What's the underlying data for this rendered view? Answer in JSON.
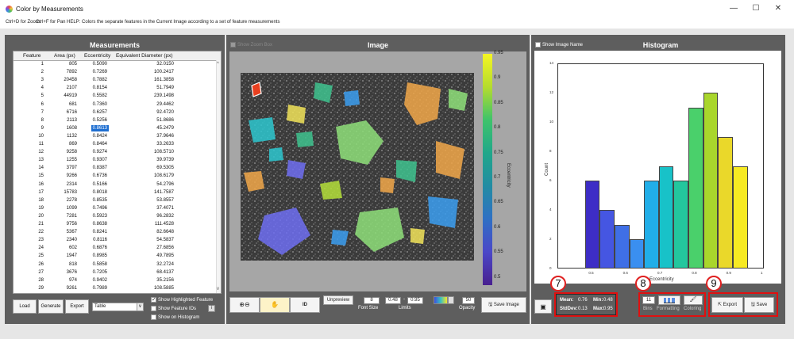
{
  "window": {
    "title": "Color by Measurements",
    "minimize": "—",
    "maximize": "☐",
    "close": "✕"
  },
  "helpbar": {
    "zoom": "Ctrl+D for Zoom",
    "pan": "Ctrl+F for Pan",
    "help": "HELP: Colors the separate features in the Current Image according to a set of feature measurements"
  },
  "help_button": "?",
  "measurements": {
    "title": "Measurements",
    "columns": [
      "Feature",
      "Area (px)",
      "Eccentricity",
      "Equivalent Diameter (px)"
    ],
    "rows": [
      [
        "1",
        "805",
        "0.5090",
        "32.0150"
      ],
      [
        "2",
        "7892",
        "0.7269",
        "100.2417"
      ],
      [
        "3",
        "20458",
        "0.7882",
        "161.3858"
      ],
      [
        "4",
        "2107",
        "0.8154",
        "51.7949"
      ],
      [
        "5",
        "44919",
        "0.5582",
        "239.1498"
      ],
      [
        "6",
        "681",
        "0.7360",
        "29.4462"
      ],
      [
        "7",
        "6716",
        "0.6257",
        "92.4720"
      ],
      [
        "8",
        "2113",
        "0.5256",
        "51.8686"
      ],
      [
        "9",
        "1608",
        "0.8613",
        "45.2479"
      ],
      [
        "10",
        "1132",
        "0.8424",
        "37.9646"
      ],
      [
        "11",
        "869",
        "0.8464",
        "33.2633"
      ],
      [
        "12",
        "9258",
        "0.9274",
        "108.5710"
      ],
      [
        "13",
        "1255",
        "0.9307",
        "39.9739"
      ],
      [
        "14",
        "3797",
        "0.8387",
        "69.5305"
      ],
      [
        "15",
        "9266",
        "0.6736",
        "108.6179"
      ],
      [
        "16",
        "2314",
        "0.5166",
        "54.2796"
      ],
      [
        "17",
        "15783",
        "0.8018",
        "141.7587"
      ],
      [
        "18",
        "2278",
        "0.8535",
        "53.8557"
      ],
      [
        "19",
        "1099",
        "0.7496",
        "37.4071"
      ],
      [
        "20",
        "7281",
        "0.5923",
        "96.2832"
      ],
      [
        "21",
        "9756",
        "0.8638",
        "111.4528"
      ],
      [
        "22",
        "5367",
        "0.8241",
        "82.6648"
      ],
      [
        "23",
        "2340",
        "0.8116",
        "54.5837"
      ],
      [
        "24",
        "602",
        "0.6876",
        "27.6856"
      ],
      [
        "25",
        "1947",
        "0.8985",
        "49.7895"
      ],
      [
        "26",
        "818",
        "0.5858",
        "32.2724"
      ],
      [
        "27",
        "3676",
        "0.7205",
        "68.4137"
      ],
      [
        "28",
        "974",
        "0.9402",
        "35.2156"
      ],
      [
        "29",
        "9261",
        "0.7989",
        "108.5885"
      ]
    ],
    "selected_row": 8,
    "buttons": {
      "load": "Load",
      "generate": "Generate",
      "export": "Export"
    },
    "export_format": "Table",
    "dropdown_arrow": "∨",
    "checks": {
      "highlighted": "Show Highlighted Feature",
      "ids": "Show Feature IDs",
      "on_histogram": "Show on Histogram"
    },
    "ids_info": "i"
  },
  "image_panel": {
    "title": "Image",
    "show_zoom_box": "Show Zoom Box",
    "colorbar": {
      "label": "Eccentricity",
      "ticks": [
        "0.95",
        "0.9",
        "0.85",
        "0.8",
        "0.75",
        "0.7",
        "0.65",
        "0.6",
        "0.55",
        "0.5"
      ]
    },
    "tools": {
      "id": "ID",
      "unpreview": "Unpreview",
      "save_image": "Save Image"
    },
    "font_size": {
      "value": "8",
      "label": "Font Size"
    },
    "limits": {
      "low": "0.48",
      "high": "0.95",
      "label": "Limits",
      "sep": "-"
    },
    "opacity": {
      "value": "50",
      "label": "Opacity"
    }
  },
  "histogram_panel": {
    "title": "Histogram",
    "show_image_name": "Show Image Name",
    "xlabel": "Eccentricity",
    "ylabel": "Count",
    "stats": {
      "mean_label": "Mean:",
      "mean": "0.76",
      "min_label": "Min:",
      "min": "0.48",
      "stdev_label": "StdDev:",
      "stdev": "0.13",
      "max_label": "Max:",
      "max": "0.95"
    },
    "bins": {
      "value": "11",
      "label": "Bins"
    },
    "formatting": "Formatting",
    "coloring": "Coloring",
    "export": "Export",
    "save": "Save",
    "markers": [
      "7",
      "8",
      "9"
    ]
  },
  "chart_data": {
    "type": "bar",
    "xlabel": "Eccentricity",
    "ylabel": "Count",
    "xlim": [
      0.4,
      1.0
    ],
    "ylim": [
      0,
      14
    ],
    "xticks": [
      "0.5",
      "0.6",
      "0.7",
      "0.8",
      "0.9",
      "1"
    ],
    "yticks": [
      "0",
      "2",
      "4",
      "6",
      "8",
      "10",
      "12",
      "14"
    ],
    "bin_edges": [
      0.48,
      0.523,
      0.566,
      0.609,
      0.652,
      0.695,
      0.738,
      0.781,
      0.824,
      0.867,
      0.91,
      0.953
    ],
    "values": [
      6,
      4,
      3,
      2,
      6,
      7,
      6,
      11,
      12,
      9,
      7
    ],
    "colors": [
      "#3d2dc6",
      "#4556e2",
      "#3f6fe6",
      "#3a8ff0",
      "#21aee8",
      "#18c2c8",
      "#23c79e",
      "#4ad06b",
      "#a9d62c",
      "#ead82a",
      "#f7ea23"
    ]
  }
}
